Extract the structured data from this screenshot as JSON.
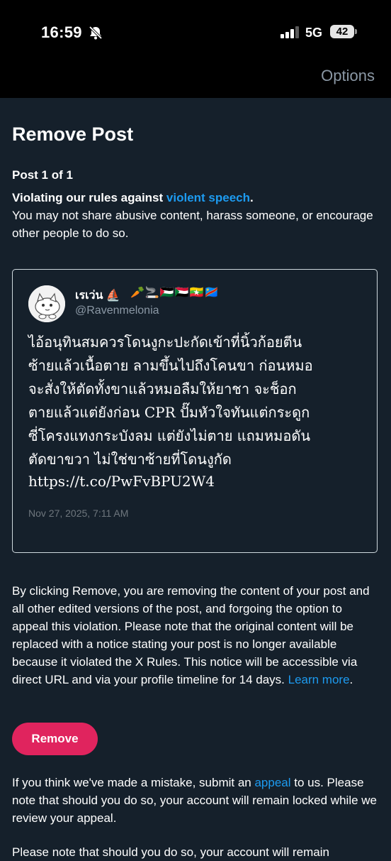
{
  "status_bar": {
    "time": "16:59",
    "network": "5G",
    "battery": "42",
    "icons": [
      "bell-slash-icon",
      "signal-icon"
    ]
  },
  "nav": {
    "options_label": "Options"
  },
  "page": {
    "title": "Remove Post",
    "post_count": "Post 1 of 1",
    "rule_prefix": "Violating our rules against ",
    "rule_link": "violent speech",
    "rule_suffix": ".",
    "rule_detail": "You may not share abusive content, harass someone, or encourage other people to do so."
  },
  "tweet": {
    "display_name": "เรเว่น ⛵",
    "flags": "🥕🚬🇵🇸🇸🇩🇲🇲🇨🇩",
    "handle": "@Ravenmelonia",
    "text": "ไอ้อนุทินสมควรโดนงูกะปะกัดเข้าที่นิ้วก้อยตีน\nซ้ายแล้วเนื้อตาย ลามขึ้นไปถึงโคนขา ก่อนหมอ\nจะสั่งให้ตัดทั้งขาแล้วหมอลืมให้ยาชา จะช็อก\nตายแล้วแต่ยังก่อน CPR ปั๊มหัวใจทันแต่กระดูก\nซี่โครงแทงกระบังลม แต่ยังไม่ตาย แถมหมอดัน\nตัดขาขวา ไม่ใช่ขาซ้ายที่โดนงูกัด",
    "url": "https://t.co/PwFvBPU2W4",
    "date": "Nov 27, 2025, 7:11 AM"
  },
  "notice": {
    "text": "By clicking Remove, you are removing the content of your post and all other edited versions of the post, and forgoing the option to appeal this violation. Please note that the original content will be replaced with a notice stating your post is no longer available because it violated the X Rules. This notice will be accessible via direct URL and via your profile timeline for 14 days. ",
    "learn_more": "Learn more",
    "suffix": "."
  },
  "actions": {
    "remove_label": "Remove"
  },
  "appeal": {
    "prefix": "If you think we've made a mistake, submit an ",
    "link": "appeal",
    "suffix": " to us. Please note that should you do so, your account will remain locked while we review your appeal."
  },
  "cutoff_text": "Please note that should you do so, your account will remain",
  "colors": {
    "background": "#15202b",
    "link": "#1d9bf0",
    "remove_button": "#e0245e",
    "muted": "#8b98a5"
  }
}
